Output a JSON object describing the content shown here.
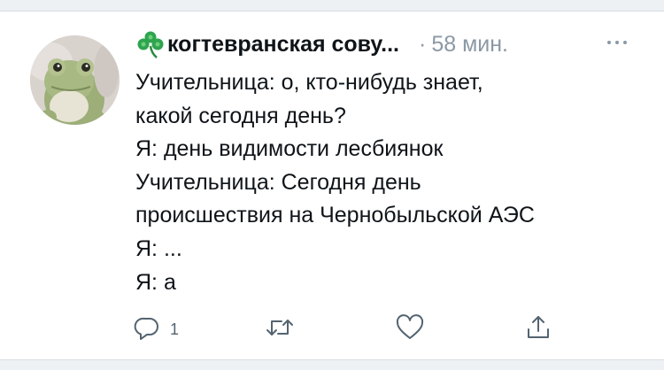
{
  "tweet": {
    "display_name": "когтевранская сову...",
    "separator": "·",
    "timestamp": "58 мин.",
    "lines": [
      "Учительница: о, кто-нибудь знает,",
      "какой сегодня день?",
      "Я: день видимости лесбиянок",
      "Учительница: Сегодня день",
      "происшествия на Чернобыльской АЭС",
      "Я: ...",
      "Я: а"
    ],
    "reply_count": "1"
  },
  "icons": {
    "name_emoji": "shamrock-icon",
    "more": "more-icon",
    "reply": "reply-icon",
    "retweet": "retweet-icon",
    "like": "heart-icon",
    "share": "share-icon"
  },
  "colors": {
    "text": "#0f1419",
    "secondary": "#8b98a5",
    "action": "#536471",
    "clover": "#2ea44f"
  }
}
